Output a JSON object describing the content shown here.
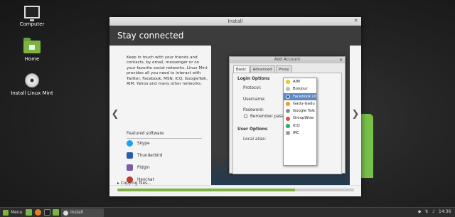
{
  "desktop": {
    "icons": [
      {
        "label": "Computer"
      },
      {
        "label": "Home"
      },
      {
        "label": "Install Linux Mint"
      }
    ]
  },
  "installer": {
    "title": "Install",
    "header": "Stay connected",
    "description": "Keep in touch with your friends and contacts, by email, messenger or on your favorite social networks. Linux Mint provides all you need to interact with Twitter, Facebook, MSN, ICQ, GoogleTalk, AIM, Yahoo and many other networks.",
    "featured_title": "Featured software",
    "featured": [
      {
        "name": "Skype",
        "icon": "skype-icon",
        "color": "#1da1f2"
      },
      {
        "name": "Thunderbird",
        "icon": "thunderbird-icon",
        "color": "#2a5ea8"
      },
      {
        "name": "Pidgin",
        "icon": "pidgin-icon",
        "color": "#7b5aa6"
      },
      {
        "name": "Hexchat",
        "icon": "hexchat-icon",
        "color": "#c0392b"
      }
    ],
    "nav_prev": "❮",
    "nav_next": "❯",
    "progress_label": "Copying files...",
    "progress": 0.75
  },
  "add_account": {
    "title": "Add Account",
    "tabs": [
      "Basic",
      "Advanced",
      "Proxy"
    ],
    "active_tab": "Basic",
    "login_options": "Login Options",
    "protocol_label": "Protocol:",
    "username_label": "Username:",
    "password_label": "Password:",
    "remember_label": "Remember passw",
    "user_options": "User Options",
    "local_alias_label": "Local alias:",
    "protocols": [
      {
        "name": "AIM",
        "color": "#f0c419"
      },
      {
        "name": "Bonjour",
        "color": "#bbbbbb"
      },
      {
        "name": "Facebook (XMPP)",
        "color": "#3b5998",
        "selected": true
      },
      {
        "name": "Gadu-Gadu",
        "color": "#f39c12"
      },
      {
        "name": "Google Talk",
        "color": "#8e8e8e"
      },
      {
        "name": "GroupWise",
        "color": "#e74c3c"
      },
      {
        "name": "ICQ",
        "color": "#27ae60"
      },
      {
        "name": "IRC",
        "color": "#999999"
      }
    ]
  },
  "taskbar": {
    "menu_label": "Menu",
    "task_label": "Install",
    "clock": "14:36"
  }
}
